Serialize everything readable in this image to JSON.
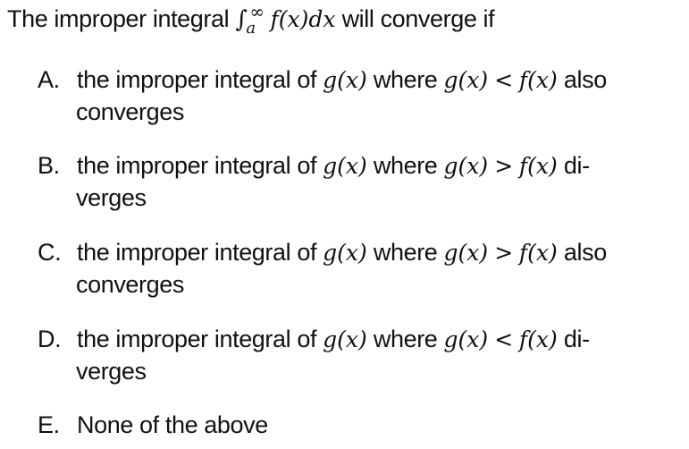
{
  "question": {
    "prefix": "The improper integral",
    "integral_symbol": "∫",
    "upper_limit": "∞",
    "lower_limit": "a",
    "integrand": "f(x)dx",
    "suffix": "will converge if"
  },
  "options": [
    {
      "label": "A.",
      "text1": "the improper integral of",
      "m1": "g(x)",
      "text2": "where",
      "m2": "g(x)",
      "rel": "<",
      "m3": "f(x)",
      "tail": "also",
      "cont": "converges"
    },
    {
      "label": "B.",
      "text1": "the improper integral of",
      "m1": "g(x)",
      "text2": "where",
      "m2": "g(x)",
      "rel": ">",
      "m3": "f(x)",
      "tail": "di-",
      "cont": "verges"
    },
    {
      "label": "C.",
      "text1": "the improper integral of",
      "m1": "g(x)",
      "text2": "where",
      "m2": "g(x)",
      "rel": ">",
      "m3": "f(x)",
      "tail": "also",
      "cont": "converges"
    },
    {
      "label": "D.",
      "text1": "the improper integral of",
      "m1": "g(x)",
      "text2": "where",
      "m2": "g(x)",
      "rel": "<",
      "m3": "f(x)",
      "tail": "di-",
      "cont": "verges"
    },
    {
      "label": "E.",
      "text1": "None of the above"
    }
  ]
}
